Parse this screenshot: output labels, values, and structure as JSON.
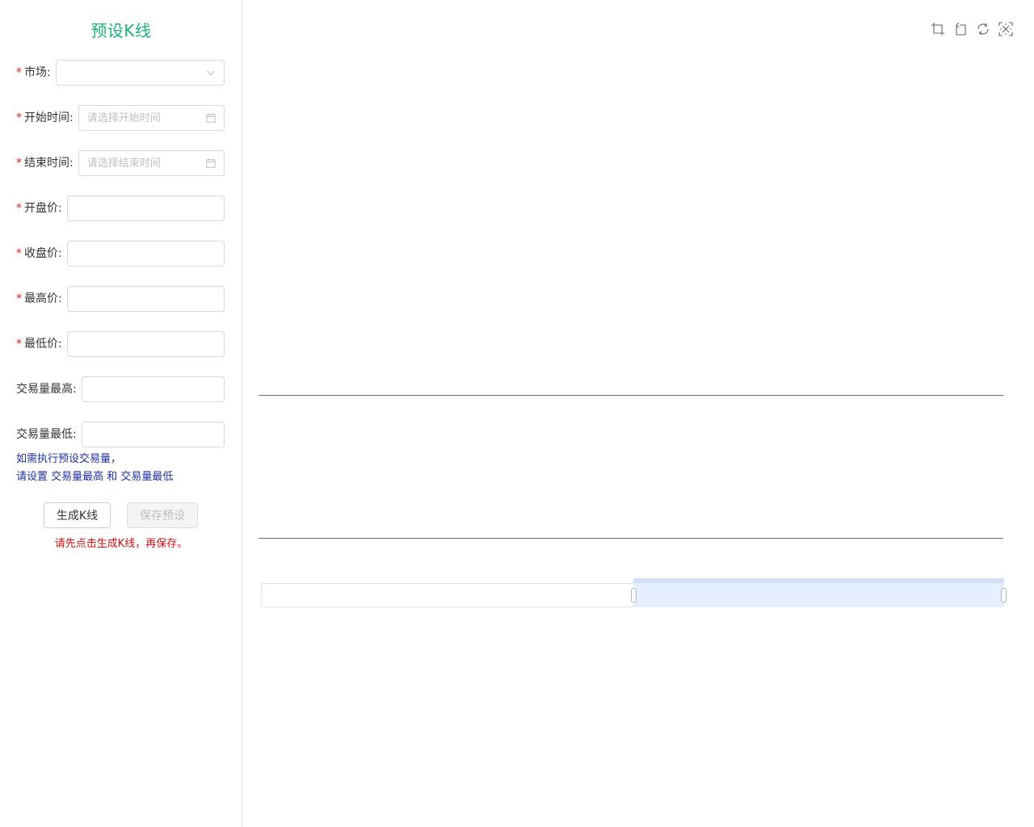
{
  "panel": {
    "title": "预设K线"
  },
  "form": {
    "market": {
      "label": "市场",
      "value": "",
      "placeholder": ""
    },
    "start_time": {
      "label": "开始时间",
      "value": "",
      "placeholder": "请选择开始时间"
    },
    "end_time": {
      "label": "结束时间",
      "value": "",
      "placeholder": "请选择结束时间"
    },
    "open_price": {
      "label": "开盘价",
      "value": ""
    },
    "close_price": {
      "label": "收盘价",
      "value": ""
    },
    "high_price": {
      "label": "最高价",
      "value": ""
    },
    "low_price": {
      "label": "最低价",
      "value": ""
    },
    "volume_high": {
      "label": "交易量最高",
      "value": ""
    },
    "volume_low": {
      "label": "交易量最低",
      "value": ""
    },
    "colon": ":",
    "required_mark": "*"
  },
  "hint": {
    "line1": "如需执行预设交易量，",
    "line2": "请设置 交易量最高 和 交易量最低"
  },
  "buttons": {
    "generate": "生成K线",
    "save": "保存预设"
  },
  "warning": "请先点击生成K线，再保存。",
  "chart": {
    "toolbox_icons": [
      "zoom-icon",
      "zoom-reset-icon",
      "restore-icon",
      "save-image-icon"
    ],
    "data_zoom": {
      "start_percent": 50,
      "end_percent": 100
    },
    "colors": {
      "title": "#1bb27a",
      "hint": "#1f2f9e",
      "warning": "#d01010",
      "zoom_fill": "#e6efff"
    }
  }
}
